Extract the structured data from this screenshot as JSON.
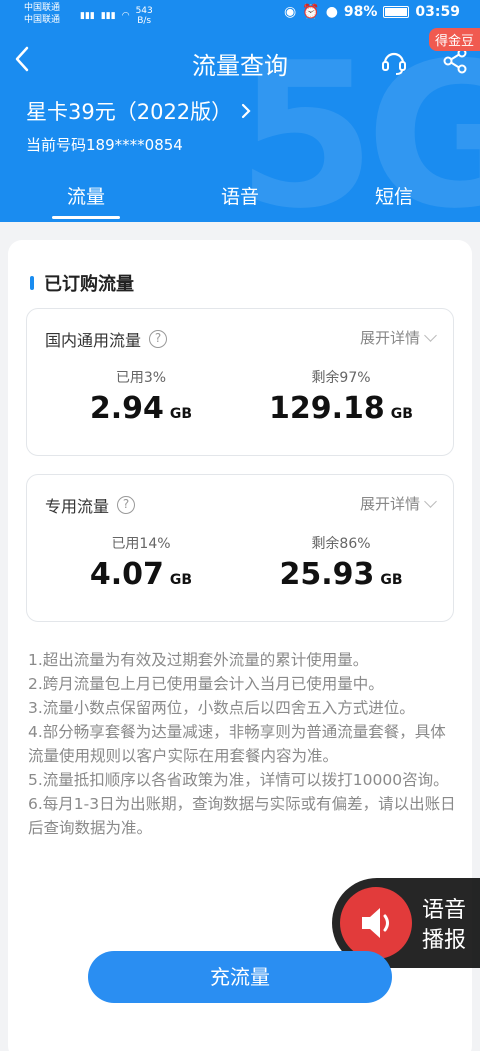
{
  "statusbar": {
    "carrier1": "中国联通",
    "carrier2": "中国联通",
    "net_speed": "543",
    "net_speed_unit": "B/s",
    "battery": "98%",
    "time": "03:59"
  },
  "navbar": {
    "title": "流量查询",
    "coin_badge": "得金豆"
  },
  "plan": {
    "name": "星卡39元（2022版）",
    "phone_label": "当前号码",
    "phone": "189****0854"
  },
  "tabs": [
    {
      "label": "流量"
    },
    {
      "label": "语音"
    },
    {
      "label": "短信"
    }
  ],
  "section": {
    "title": "已订购流量"
  },
  "boxes": [
    {
      "title": "国内通用流量",
      "expand": "展开详情",
      "used_label": "已用3%",
      "used_value": "2.94",
      "used_unit": "GB",
      "remain_label": "剩余97%",
      "remain_value": "129.18",
      "remain_unit": "GB"
    },
    {
      "title": "专用流量",
      "expand": "展开详情",
      "used_label": "已用14%",
      "used_value": "4.07",
      "used_unit": "GB",
      "remain_label": "剩余86%",
      "remain_value": "25.93",
      "remain_unit": "GB"
    }
  ],
  "notes": [
    "1.超出流量为有效及过期套外流量的累计使用量。",
    "2.跨月流量包上月已使用量会计入当月已使用量中。",
    "3.流量小数点保留两位，小数点后以四舍五入方式进位。",
    "4.部分畅享套餐为达量减速，非畅享则为普通流量套餐，具体流量使用规则以客户实际在用套餐内容为准。",
    "5.流量抵扣顺序以各省政策为准，详情可以拨打10000咨询。",
    "6.每月1-3日为出账期，查询数据与实际或有偏差，请以出账日后查询数据为准。"
  ],
  "voice": {
    "line1": "语音",
    "line2": "播报"
  },
  "recharge_button": "充流量",
  "colors": {
    "brand": "#1a8cf0",
    "button": "#2a8ef2",
    "badge": "#f05a50",
    "voice": "#e23b3b"
  }
}
